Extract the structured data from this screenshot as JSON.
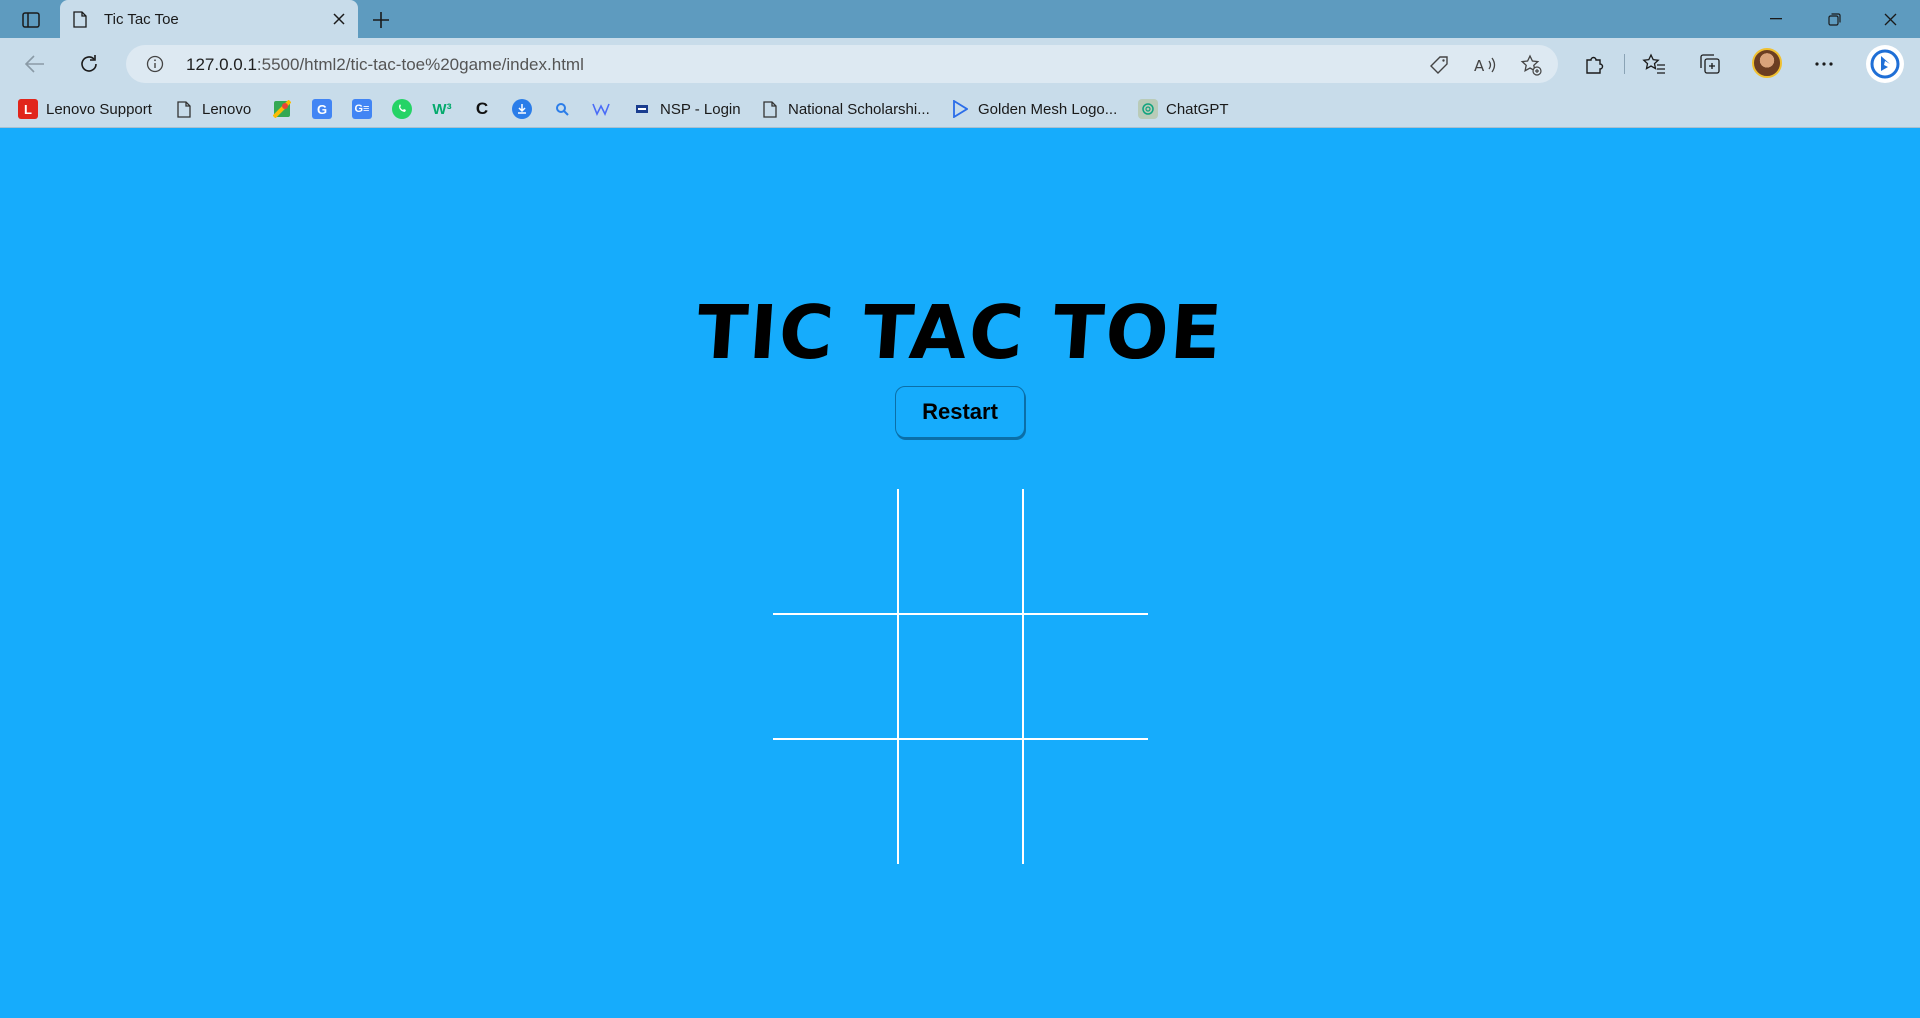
{
  "browser": {
    "tab": {
      "title": "Tic Tac Toe"
    },
    "address": {
      "host": "127.0.0.1",
      "rest": ":5500/html2/tic-tac-toe%20game/index.html"
    },
    "bookmarks": [
      {
        "label": "Lenovo Support",
        "icon": "lenovo-l-icon",
        "color": "#e1251b"
      },
      {
        "label": "Lenovo",
        "icon": "page-icon",
        "color": "#444444"
      },
      {
        "label": "",
        "icon": "maps-icon",
        "color": "#34a853"
      },
      {
        "label": "",
        "icon": "translate-icon",
        "color": "#4285f4"
      },
      {
        "label": "",
        "icon": "google-edu-icon",
        "color": "#4285f4"
      },
      {
        "label": "",
        "icon": "whatsapp-icon",
        "color": "#25d366"
      },
      {
        "label": "",
        "icon": "w3schools-icon",
        "color": "#04aa6d"
      },
      {
        "label": "",
        "icon": "c-icon",
        "color": "#111111"
      },
      {
        "label": "",
        "icon": "download-icon",
        "color": "#2b7de9"
      },
      {
        "label": "",
        "icon": "search-icon",
        "color": "#2b7de9"
      },
      {
        "label": "",
        "icon": "webflow-icon",
        "color": "#4a6cf7"
      },
      {
        "label": "NSP - Login",
        "icon": "nsp-icon",
        "color": "#1a3d8f"
      },
      {
        "label": "National Scholarshi...",
        "icon": "page-icon",
        "color": "#444444"
      },
      {
        "label": "Golden Mesh Logo...",
        "icon": "play-icon",
        "color": "#2b6de9"
      },
      {
        "label": "ChatGPT",
        "icon": "chatgpt-icon",
        "color": "#10a37f"
      }
    ]
  },
  "page": {
    "title": "TIC TAC TOE",
    "restart_label": "Restart",
    "cells": [
      "",
      "",
      "",
      "",
      "",
      "",
      "",
      "",
      ""
    ],
    "background": "#16acfc"
  }
}
